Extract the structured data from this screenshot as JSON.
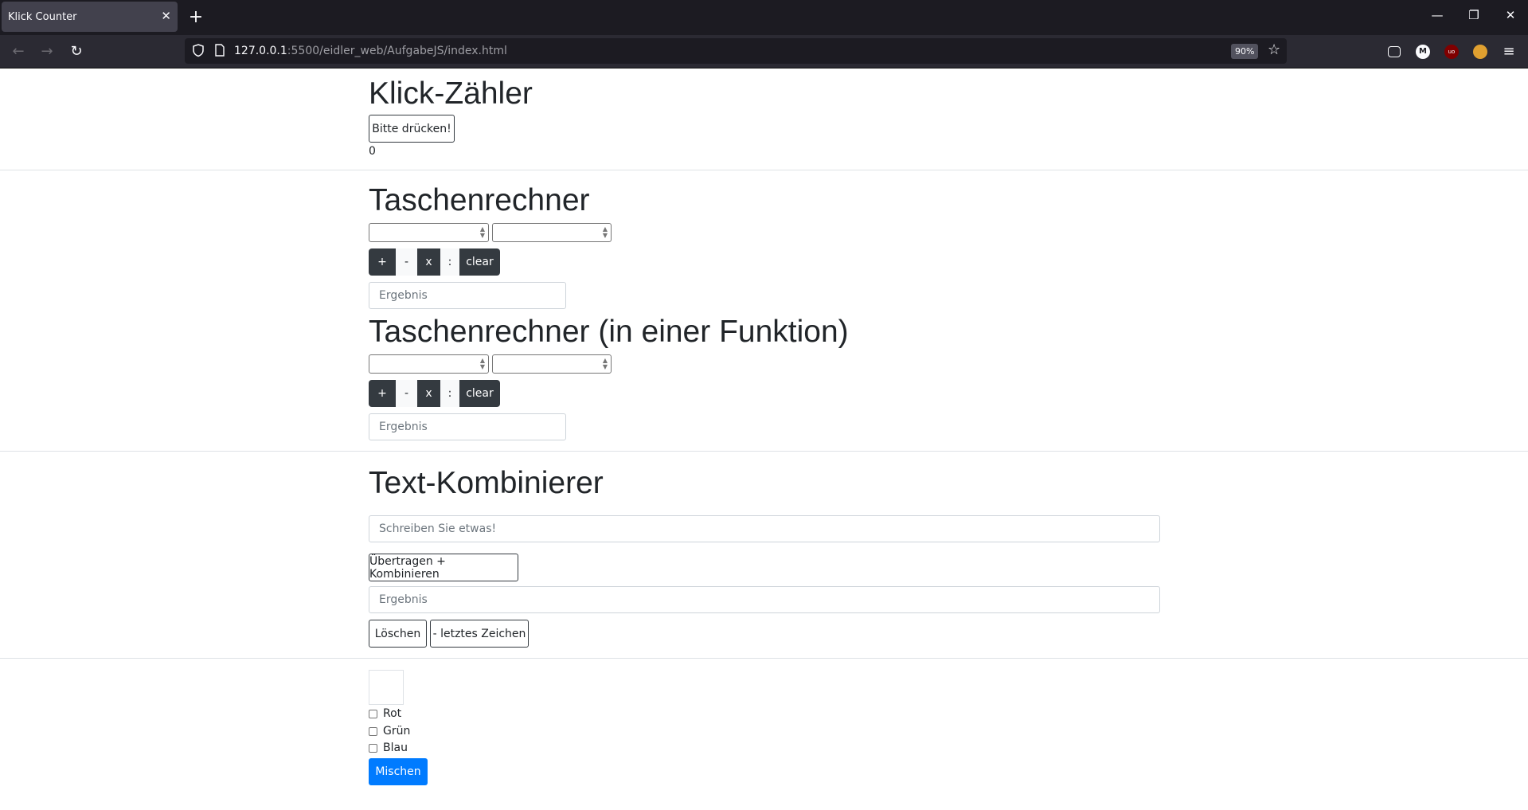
{
  "browser": {
    "tab_title": "Klick Counter",
    "url_host": "127.0.0.1",
    "url_rest": ":5500/eidler_web/AufgabeJS/index.html",
    "zoom": "90%"
  },
  "klick": {
    "title": "Klick-Zähler",
    "button": "Bitte drücken!",
    "count": "0"
  },
  "rechner1": {
    "title": "Taschenrechner",
    "ops": [
      "+",
      "-",
      "x",
      ":"
    ],
    "clear": "clear",
    "result_placeholder": "Ergebnis"
  },
  "rechner2": {
    "title": "Taschenrechner (in einer Funktion)",
    "ops": [
      "+",
      "-",
      "x",
      ":"
    ],
    "clear": "clear",
    "result_placeholder": "Ergebnis"
  },
  "text": {
    "title": "Text-Kombinierer",
    "input_placeholder": "Schreiben Sie etwas!",
    "combine_button": "Übertragen + Kombinieren",
    "result_placeholder": "Ergebnis",
    "delete_button": "Löschen",
    "last_char_button": "- letztes Zeichen"
  },
  "farben": {
    "options": [
      "Rot",
      "Grün",
      "Blau"
    ],
    "mix_button": "Mischen"
  }
}
